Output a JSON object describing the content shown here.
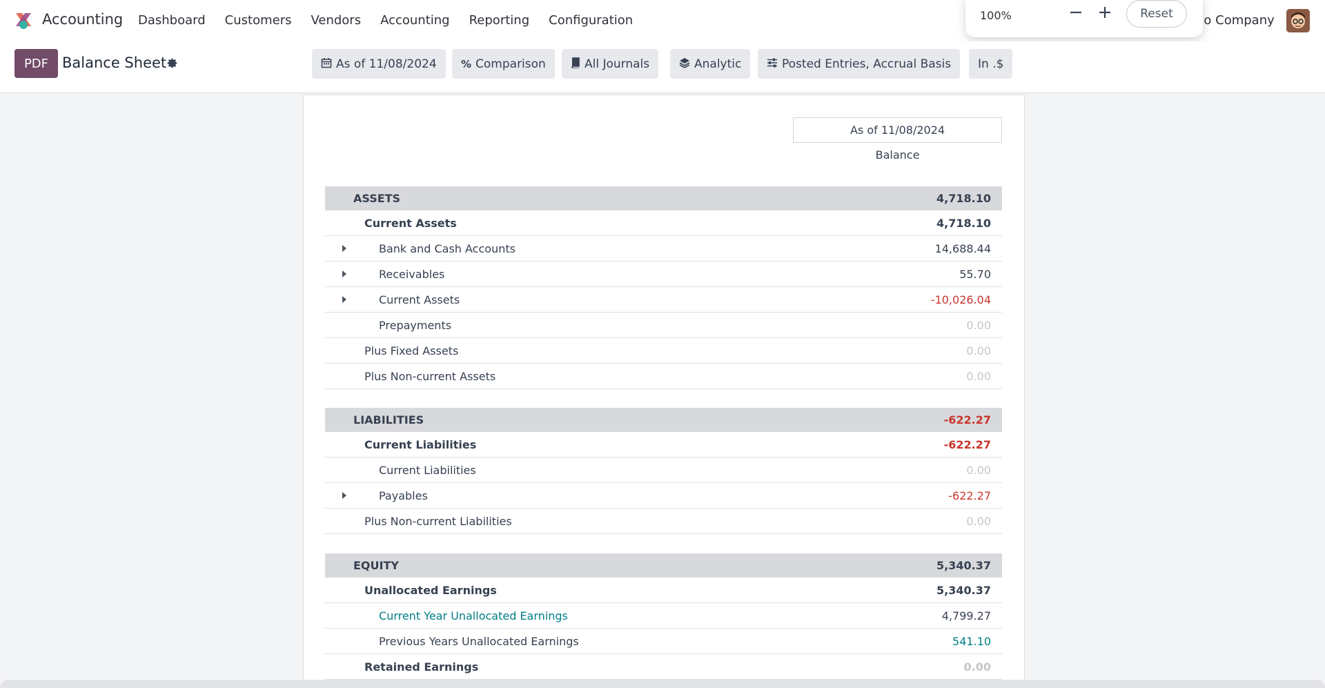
{
  "navbar": {
    "app_name": "Accounting",
    "menu": [
      "Dashboard",
      "Customers",
      "Vendors",
      "Accounting",
      "Reporting",
      "Configuration"
    ],
    "company": "no Company"
  },
  "zoom": {
    "level": "100%",
    "reset_label": "Reset"
  },
  "controls": {
    "pdf_label": "PDF",
    "title": "Balance Sheet",
    "filters": {
      "date": "As of 11/08/2024",
      "comparison": "Comparison",
      "journals": "All Journals",
      "analytic": "Analytic",
      "options": "Posted Entries, Accrual Basis",
      "currency": "In .$"
    }
  },
  "report": {
    "column_header": "As of 11/08/2024",
    "column_subheader": "Balance",
    "rows": [
      {
        "label": "ASSETS",
        "value": "4,718.10"
      },
      {
        "label": "Current Assets",
        "value": "4,718.10"
      },
      {
        "label": "Bank and Cash Accounts",
        "value": "14,688.44"
      },
      {
        "label": "Receivables",
        "value": "55.70"
      },
      {
        "label": "Current Assets",
        "value": "-10,026.04"
      },
      {
        "label": "Prepayments",
        "value": "0.00"
      },
      {
        "label": "Plus Fixed Assets",
        "value": "0.00"
      },
      {
        "label": "Plus Non-current Assets",
        "value": "0.00"
      },
      {
        "label": "LIABILITIES",
        "value": "-622.27"
      },
      {
        "label": "Current Liabilities",
        "value": "-622.27"
      },
      {
        "label": "Current Liabilities",
        "value": "0.00"
      },
      {
        "label": "Payables",
        "value": "-622.27"
      },
      {
        "label": "Plus Non-current Liabilities",
        "value": "0.00"
      },
      {
        "label": "EQUITY",
        "value": "5,340.37"
      },
      {
        "label": "Unallocated Earnings",
        "value": "5,340.37"
      },
      {
        "label": "Current Year Unallocated Earnings",
        "value": "4,799.27"
      },
      {
        "label": "Previous Years Unallocated Earnings",
        "value": "541.10"
      },
      {
        "label": "Retained Earnings",
        "value": "0.00"
      }
    ]
  },
  "colors": {
    "brand": "#714b67",
    "negative": "#c8352c",
    "link": "#017e84",
    "section_bg": "#d8d9dc"
  }
}
